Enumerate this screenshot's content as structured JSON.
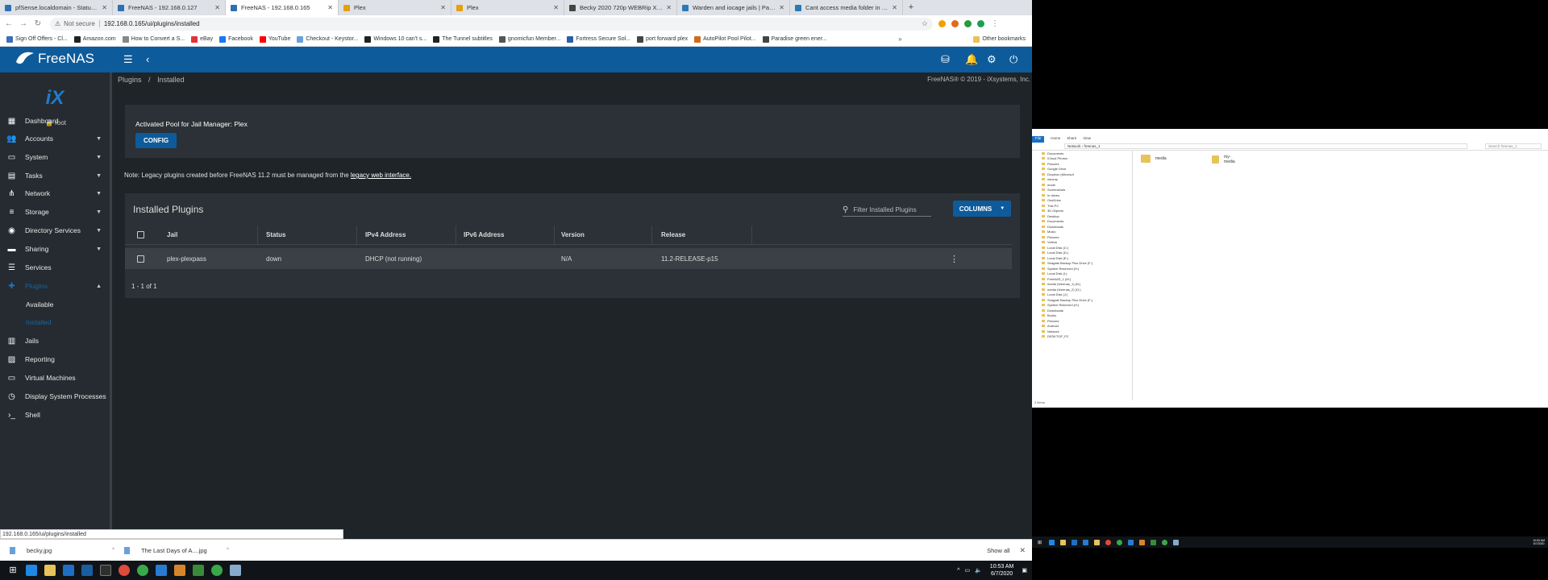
{
  "browser": {
    "tabs": [
      {
        "title": "pfSense.localdomain - Status: D",
        "color": "#2f6fb5"
      },
      {
        "title": "FreeNAS - 192.168.0.127",
        "color": "#2f6fb5"
      },
      {
        "title": "FreeNAS - 192.168.0.165",
        "color": "#2f6fb5"
      },
      {
        "title": "Plex",
        "color": "#e5a00d"
      },
      {
        "title": "Plex",
        "color": "#e5a00d"
      },
      {
        "title": "Becky 2020 720p WEBRip X264-A",
        "color": "#444"
      },
      {
        "title": "Warden and iocage jails | Page 2",
        "color": "#2a7ab8"
      },
      {
        "title": "Cant access media folder in fre",
        "color": "#2a7ab8"
      }
    ],
    "new_tab": "+",
    "security_label": "Not secure",
    "url": "192.168.0.165/ui/plugins/installed",
    "bookmarks": [
      {
        "label": "Sign Off Offers - Cl...",
        "color": "#3b6fb6"
      },
      {
        "label": "Amazon.com",
        "color": "#222"
      },
      {
        "label": "How to Convert a S...",
        "color": "#888"
      },
      {
        "label": "eBay",
        "color": "#e53238"
      },
      {
        "label": "Facebook",
        "color": "#1877f2"
      },
      {
        "label": "YouTube",
        "color": "#ff0000"
      },
      {
        "label": "Checkout - Keystor...",
        "color": "#6aa0d8"
      },
      {
        "label": "Windows 10 can't s...",
        "color": "#222"
      },
      {
        "label": "The Tunnel subtitles",
        "color": "#222"
      },
      {
        "label": "gnomicfun Member...",
        "color": "#555"
      },
      {
        "label": "Fortress Secure Sol...",
        "color": "#2a5ea8"
      },
      {
        "label": "port forward plex",
        "color": "#444"
      },
      {
        "label": "AutoPilot Pool Pilot...",
        "color": "#d06a1a"
      },
      {
        "label": "Paradise green ener...",
        "color": "#444"
      }
    ],
    "other_bookmarks": "Other bookmarks",
    "status_url": "192.168.0.165/ui/plugins/installed",
    "downloads": [
      {
        "name": "becky.jpg"
      },
      {
        "name": "The Last Days of A....jpg"
      }
    ],
    "show_all": "Show all"
  },
  "freenas": {
    "logo_text": "FreeNAS",
    "user": "root",
    "nav": [
      {
        "label": "Dashboard",
        "icon": "dashboard-icon",
        "glyph": "▦",
        "expand": false
      },
      {
        "label": "Accounts",
        "icon": "accounts-icon",
        "glyph": "👥",
        "expand": true
      },
      {
        "label": "System",
        "icon": "system-icon",
        "glyph": "▭",
        "expand": true
      },
      {
        "label": "Tasks",
        "icon": "tasks-icon",
        "glyph": "▤",
        "expand": true
      },
      {
        "label": "Network",
        "icon": "network-icon",
        "glyph": "⋔",
        "expand": true
      },
      {
        "label": "Storage",
        "icon": "storage-icon",
        "glyph": "≡",
        "expand": true
      },
      {
        "label": "Directory Services",
        "icon": "directory-services-icon",
        "glyph": "◉",
        "expand": true
      },
      {
        "label": "Sharing",
        "icon": "sharing-icon",
        "glyph": "▬",
        "expand": true
      },
      {
        "label": "Services",
        "icon": "services-icon",
        "glyph": "☰",
        "expand": false
      },
      {
        "label": "Plugins",
        "icon": "plugins-icon",
        "glyph": "✚",
        "expand": true,
        "active": true
      },
      {
        "label": "Available",
        "sub": true
      },
      {
        "label": "Installed",
        "sub": true,
        "active": true
      },
      {
        "label": "Jails",
        "icon": "jails-icon",
        "glyph": "▥",
        "expand": false
      },
      {
        "label": "Reporting",
        "icon": "reporting-icon",
        "glyph": "▨",
        "expand": false
      },
      {
        "label": "Virtual Machines",
        "icon": "virtual-machines-icon",
        "glyph": "▭",
        "expand": false
      },
      {
        "label": "Display System Processes",
        "icon": "processes-icon",
        "glyph": "◷",
        "expand": false
      },
      {
        "label": "Shell",
        "icon": "shell-icon",
        "glyph": "›_",
        "expand": false
      }
    ],
    "breadcrumb": {
      "parent": "Plugins",
      "separator": "/",
      "current": "Installed"
    },
    "copyright": "FreeNAS® © 2019 - iXsystems, Inc.",
    "jail_card": {
      "title": "Activated Pool for Jail Manager: Plex",
      "button": "CONFIG"
    },
    "legacy_note": {
      "prefix": "Note: Legacy plugins created before FreeNAS 11.2 must be managed from the ",
      "link": "legacy web interface."
    },
    "plugins_table": {
      "title": "Installed Plugins",
      "filter_placeholder": "Filter Installed Plugins",
      "columns_button": "COLUMNS",
      "headers": [
        "Jail",
        "Status",
        "IPv4 Address",
        "IPv6 Address",
        "Version",
        "Release"
      ],
      "rows": [
        {
          "jail": "plex-plexpass",
          "status": "down",
          "ipv4": "DHCP (not running)",
          "ipv6": "",
          "version": "N/A",
          "release": "11.2-RELEASE-p15"
        }
      ],
      "pager": "1 - 1 of 1"
    }
  },
  "taskbar": {
    "time": "10:53 AM",
    "date": "6/7/2020"
  },
  "explorer": {
    "ribbon": [
      "File",
      "Home",
      "Share",
      "View"
    ],
    "path": "Network › freenas_1",
    "search": "Search freenas_1",
    "nav_items": [
      "Documents",
      "iCloud Photos",
      "Pictures",
      "Google Drive",
      "Dropbox (Microsof",
      "mkvmp",
      "mode",
      "Screenshots",
      "In drives",
      "OneDrive",
      "This PC",
      "3D Objects",
      "Desktop",
      "Documents",
      "Downloads",
      "Music",
      "Pictures",
      "Videos",
      "Local Disk (C:)",
      "Local Disk (D:)",
      "Local Disk (E:)",
      "Seagate Backup Plus Drive (F:)",
      "System Reserved (H:)",
      "Local Disk (I:)",
      "FreeNAS_1 (M:)",
      "media (\\freenas_1) (N:)",
      "media (\\freenas_2) (O:)",
      "Local Disk (J:)",
      "Seagate Backup Plus Drive (F:)",
      "System Reserved (H:)",
      "Downloads",
      "Books",
      "Pictures",
      "Android",
      "Network",
      "DESKTOP_PC"
    ],
    "folders": [
      "media",
      "my-media"
    ],
    "status": "2 items",
    "time": "10:53 AM",
    "date": "6/7/2020"
  }
}
